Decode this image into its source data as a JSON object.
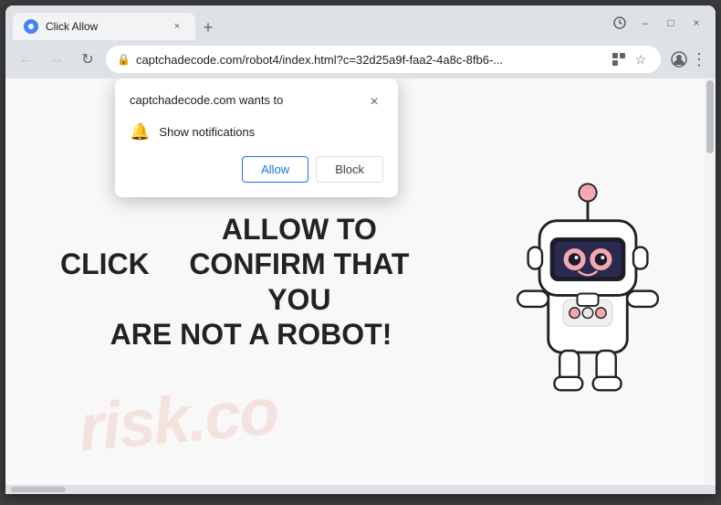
{
  "browser": {
    "tab": {
      "favicon": "⊕",
      "title": "Click Allow",
      "close_label": "×"
    },
    "new_tab_label": "+",
    "window_controls": {
      "minimize": "–",
      "maximize": "□",
      "close": "×"
    },
    "nav": {
      "back": "←",
      "forward": "→",
      "refresh": "↻"
    },
    "address": {
      "url": "captchadecode.com/robot4/index.html?c=32d25a9f-faa2-4a8c-8fb6-...",
      "lock_icon": "🔒"
    },
    "toolbar_icons": {
      "translate": "⊞",
      "bookmark": "☆",
      "profile": "⊙",
      "menu": "⋮",
      "extensions": "▼"
    }
  },
  "notification_popup": {
    "title": "captchadecode.com wants to",
    "close_label": "×",
    "permission_icon": "🔔",
    "permission_text": "Show notifications",
    "allow_label": "Allow",
    "block_label": "Block"
  },
  "page_content": {
    "main_text_line1": "CLICK ALLOW TO CONFIRM THAT YOU",
    "main_text_line2": "ARE NOT A ROBOT!",
    "watermark": "risk.co"
  },
  "colors": {
    "allow_button_text": "#1a73e8",
    "allow_button_border": "#1a73e8",
    "heading_color": "#222222",
    "popup_shadow": "rgba(0,0,0,0.25)"
  }
}
